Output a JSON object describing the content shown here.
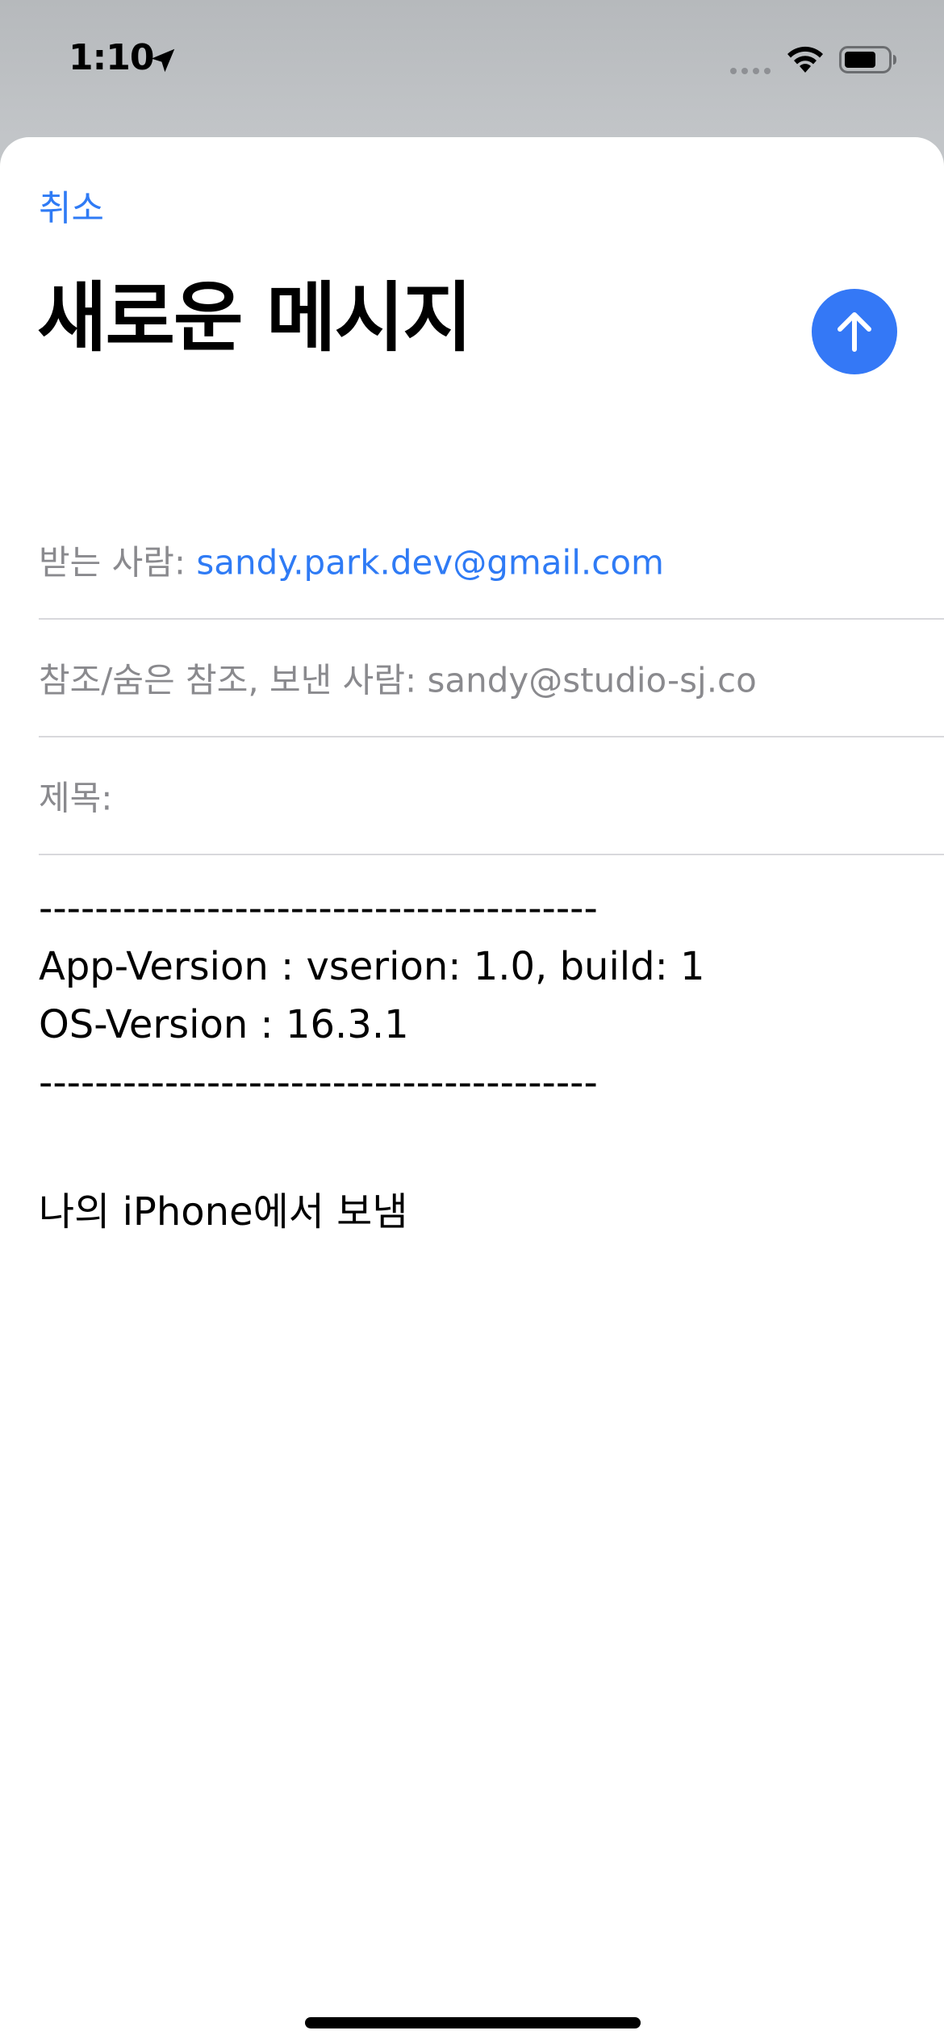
{
  "status_bar": {
    "time": "1:10",
    "location_icon": "location-arrow-icon",
    "signal_icon": "cellular-signal-icon",
    "wifi_icon": "wifi-icon",
    "battery_icon": "battery-icon"
  },
  "compose": {
    "cancel_label": "취소",
    "title": "새로운 메시지",
    "send_icon": "arrow-up-icon",
    "accent_color": "#3478f6",
    "to": {
      "label": "받는 사람:",
      "value": "sandy.park.dev@gmail.com"
    },
    "cc_from": {
      "label": "참조/숨은 참조, 보낸 사람:",
      "value": "sandy@studio-sj.co"
    },
    "subject": {
      "label": "제목:",
      "value": ""
    },
    "body_lines": [
      "----------------------------------------",
      "App-Version : vserion: 1.0, build: 1",
      "OS-Version : 16.3.1",
      "----------------------------------------"
    ],
    "signature": "나의 iPhone에서 보냄"
  }
}
